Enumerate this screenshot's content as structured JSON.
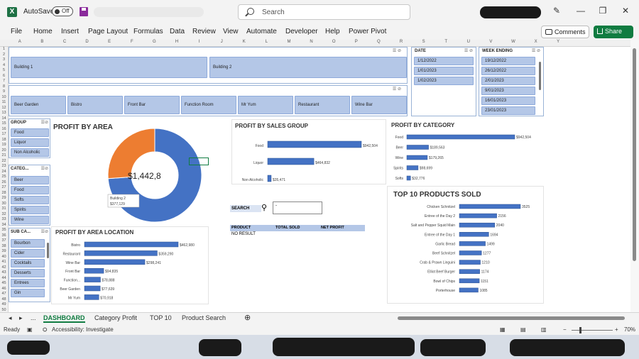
{
  "titlebar": {
    "autosave_label": "AutoSave",
    "toggle_state": "Off",
    "search_placeholder": "Search"
  },
  "ribbon": {
    "tabs": [
      "File",
      "Home",
      "Insert",
      "Page Layout",
      "Formulas",
      "Data",
      "Review",
      "View",
      "Automate",
      "Developer",
      "Help",
      "Power Pivot"
    ],
    "comments_label": "Comments",
    "share_label": "Share"
  },
  "grid": {
    "columns": [
      "A",
      "B",
      "C",
      "D",
      "E",
      "F",
      "G",
      "H",
      "I",
      "J",
      "K",
      "L",
      "M",
      "N",
      "O",
      "P",
      "Q",
      "R",
      "S",
      "T",
      "U",
      "V",
      "W",
      "X",
      "Y"
    ],
    "rows": [
      "1",
      "2",
      "3",
      "4",
      "5",
      "6",
      "7",
      "8",
      "9",
      "10",
      "11",
      "12",
      "13",
      "14",
      "15",
      "16",
      "17",
      "18",
      "19",
      "20",
      "21",
      "22",
      "23",
      "24",
      "25",
      "26",
      "27",
      "28",
      "29",
      "30",
      "31",
      "32",
      "33",
      "34",
      "35",
      "36",
      "37",
      "38",
      "39",
      "40",
      "41",
      "42",
      "43",
      "44",
      "45",
      "46",
      "47",
      "48",
      "49",
      "50"
    ]
  },
  "slicers": {
    "area": [
      "Building 1",
      "Building 2"
    ],
    "location": [
      "Beer Garden",
      "Bistro",
      "Front Bar",
      "Function Room",
      "Mr Yum",
      "Restaurant",
      "Wine Bar"
    ],
    "date": {
      "title": "DATE",
      "items": [
        "1/12/2022",
        "1/01/2023",
        "1/02/2023"
      ]
    },
    "week_ending": {
      "title": "WEEK ENDING",
      "items": [
        "19/12/2022",
        "26/12/2022",
        "2/01/2023",
        "9/01/2023",
        "16/01/2023",
        "23/01/2023"
      ]
    },
    "group": {
      "title": "GROUP",
      "items": [
        "Food",
        "Liquor",
        "Non Alcoholic"
      ]
    },
    "category": {
      "title": "CATEG...",
      "items": [
        "Beer",
        "Food",
        "Softs",
        "Spirits",
        "Wine"
      ]
    },
    "sub_category": {
      "title": "SUB CA...",
      "items": [
        "Bourbon",
        "Cider",
        "Cocktails",
        "Desserts",
        "Entrees",
        "Gin"
      ]
    }
  },
  "search_panel": {
    "label": "SEARCH",
    "input_value": "-",
    "headers": [
      "PRODUCT",
      "TOTAL SOLD",
      "NET PROFIT"
    ],
    "result": "NO RESULT"
  },
  "chart_data": [
    {
      "type": "pie",
      "title": "PROFIT BY AREA",
      "center_label": "$1,442,8",
      "labels": [
        "Building 1",
        "Building 2"
      ],
      "value_labels": [
        "$1,065,678",
        "$377,129"
      ],
      "values": [
        1065678,
        377129
      ],
      "colors": [
        "#4472c4",
        "#ed7d31"
      ]
    },
    {
      "type": "bar",
      "title": "PROFIT BY SALES GROUP",
      "categories": [
        "Food",
        "Liquor",
        "Non Alcoholic"
      ],
      "values": [
        942504,
        464832,
        35471
      ],
      "value_labels": [
        "$942,504",
        "$464,832",
        "$35,471"
      ],
      "max": 942504
    },
    {
      "type": "bar",
      "title": "PROFIT BY CATEGORY",
      "categories": [
        "Food",
        "Beer",
        "Wine",
        "Spirits",
        "Softs"
      ],
      "values": [
        942504,
        189563,
        179265,
        98699,
        32776
      ],
      "value_labels": [
        "$942,504",
        "$189,563",
        "$179,265",
        "$98,699",
        "$32,776"
      ],
      "max": 942504
    },
    {
      "type": "bar",
      "title": "PROFIT BY AREA LOCATION",
      "categories": [
        "Bistro",
        "Restaurant",
        "Wine Bar",
        "Front Bar",
        "Function...",
        "Beer Garden",
        "Mr Yum"
      ],
      "values": [
        462980,
        359290,
        298241,
        94835,
        78888,
        77639,
        70918
      ],
      "value_labels": [
        "$462,980",
        "$359,290",
        "$298,241",
        "$94,835",
        "$78,888",
        "$77,639",
        "$70,918"
      ],
      "max": 462980
    },
    {
      "type": "bar",
      "title": "TOP 10 PRODUCTS SOLD",
      "categories": [
        "Chicken Schnitzel",
        "Entree of the Day 2",
        "Salt and Pepper Squid Main",
        "Entree of the Day 1",
        "Garlic Bread",
        "Beef Schnitzel",
        "Crab & Prawn Linguini",
        "Elliot Beef Burger",
        "Bowl of Chips",
        "Porterhouse"
      ],
      "values": [
        3525,
        2156,
        2040,
        1694,
        1499,
        1277,
        1210,
        1174,
        1151,
        1085
      ],
      "max": 3525
    }
  ],
  "sheet_tabs": {
    "more": "...",
    "tabs": [
      "DASHBOARD",
      "Category Profit",
      "TOP 10",
      "Product Search"
    ]
  },
  "status": {
    "ready": "Ready",
    "accessibility": "Accessibility: Investigate",
    "zoom": "70%"
  }
}
